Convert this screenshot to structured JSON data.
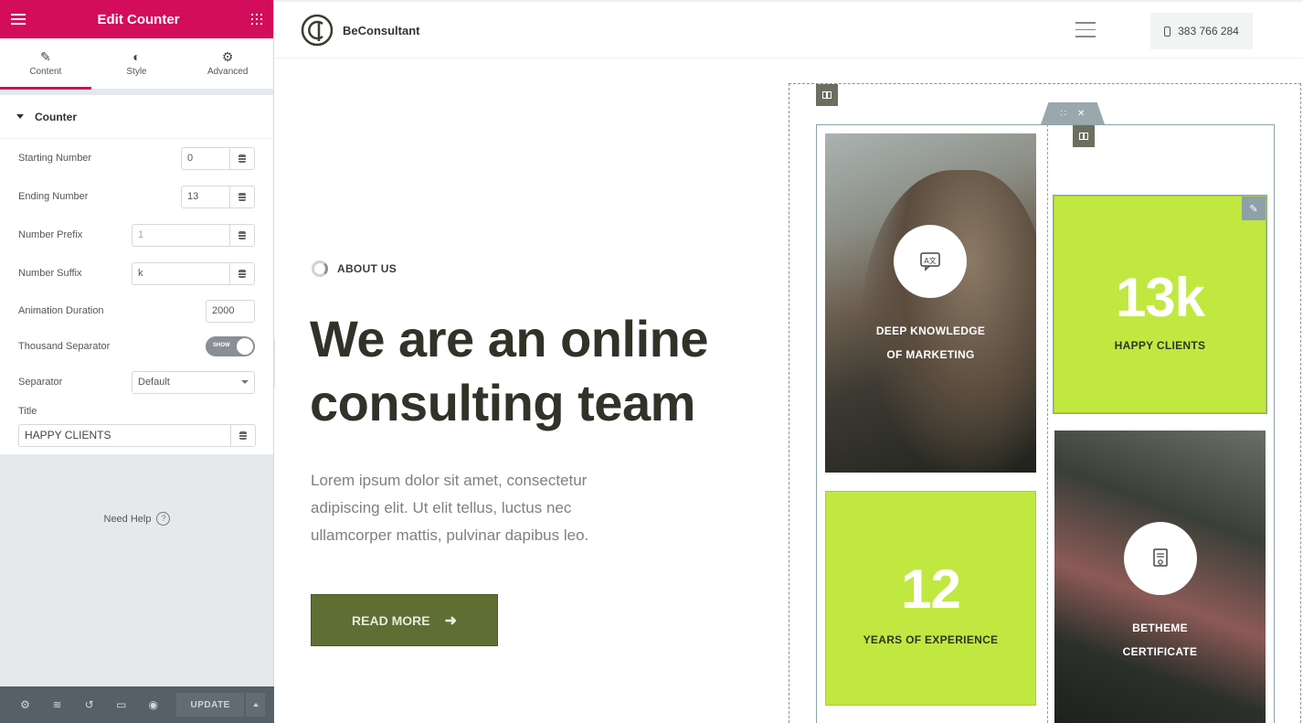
{
  "editor": {
    "header_title": "Edit Counter",
    "tabs": [
      {
        "label": "Content",
        "icon": "pencil-icon"
      },
      {
        "label": "Style",
        "icon": "half-circle-icon"
      },
      {
        "label": "Advanced",
        "icon": "gear-icon"
      }
    ],
    "section_title": "Counter",
    "fields": {
      "starting_number": {
        "label": "Starting Number",
        "value": "0"
      },
      "ending_number": {
        "label": "Ending Number",
        "value": "13"
      },
      "number_prefix": {
        "label": "Number Prefix",
        "placeholder": "1"
      },
      "number_suffix": {
        "label": "Number Suffix",
        "value": "k"
      },
      "animation_duration": {
        "label": "Animation Duration",
        "value": "2000"
      },
      "thousand_separator": {
        "label": "Thousand Separator",
        "toggle_text": "SHOW"
      },
      "separator": {
        "label": "Separator",
        "value": "Default"
      },
      "title": {
        "label": "Title",
        "value": "HAPPY CLIENTS"
      }
    },
    "need_help": "Need Help",
    "footer": {
      "update_label": "UPDATE"
    },
    "accent_color": "#d30c5c"
  },
  "site": {
    "brand": "BeConsultant",
    "phone": "383 766 284",
    "kicker": "ABOUT US",
    "headline": "We are an online consulting team",
    "lead": "Lorem ipsum dolor sit amet, consectetur adipiscing elit. Ut elit tellus, luctus nec ullamcorper mattis, pulvinar dapibus leo.",
    "cta_label": "READ MORE",
    "cards": {
      "knowledge": {
        "line1": "DEEP KNOWLEDGE",
        "line2": "OF MARKETING"
      },
      "clients": {
        "number": "13k",
        "label": "HAPPY CLIENTS"
      },
      "experience": {
        "number": "12",
        "label": "YEARS OF EXPERIENCE"
      },
      "certificate": {
        "line1": "BETHEME",
        "line2": "CERTIFICATE"
      }
    },
    "lime_color": "#c1e840",
    "olive_color": "#5f6e33"
  }
}
